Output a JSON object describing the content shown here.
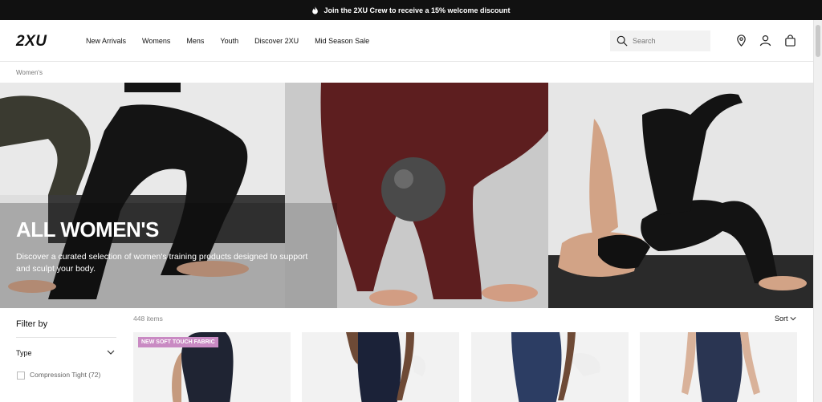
{
  "promo": {
    "text": "Join the 2XU Crew to receive a 15% welcome discount",
    "icon": "flame-icon"
  },
  "header": {
    "logo": "2XU",
    "nav": [
      "New Arrivals",
      "Womens",
      "Mens",
      "Youth",
      "Discover 2XU",
      "Mid Season Sale"
    ],
    "search_placeholder": "Search"
  },
  "breadcrumb": "Women's",
  "hero": {
    "title": "ALL WOMEN'S",
    "description": "Discover a curated selection of women's training products designed to support and sculpt your body."
  },
  "filters": {
    "title": "Filter by",
    "type_label": "Type",
    "options": [
      {
        "label": "Compression Tight (72)",
        "checked": false
      }
    ]
  },
  "listing": {
    "count": "448 items",
    "sort_label": "Sort",
    "products": [
      {
        "badge": "NEW SOFT TOUCH FABRIC",
        "color": "#1f2433"
      },
      {
        "badge": "",
        "color": "#1b2238"
      },
      {
        "badge": "",
        "color": "#2c3d63"
      },
      {
        "badge": "",
        "color": "#2a3552"
      }
    ]
  },
  "colors": {
    "accent_badge": "#c98ac3",
    "promo_bg": "#111111"
  }
}
